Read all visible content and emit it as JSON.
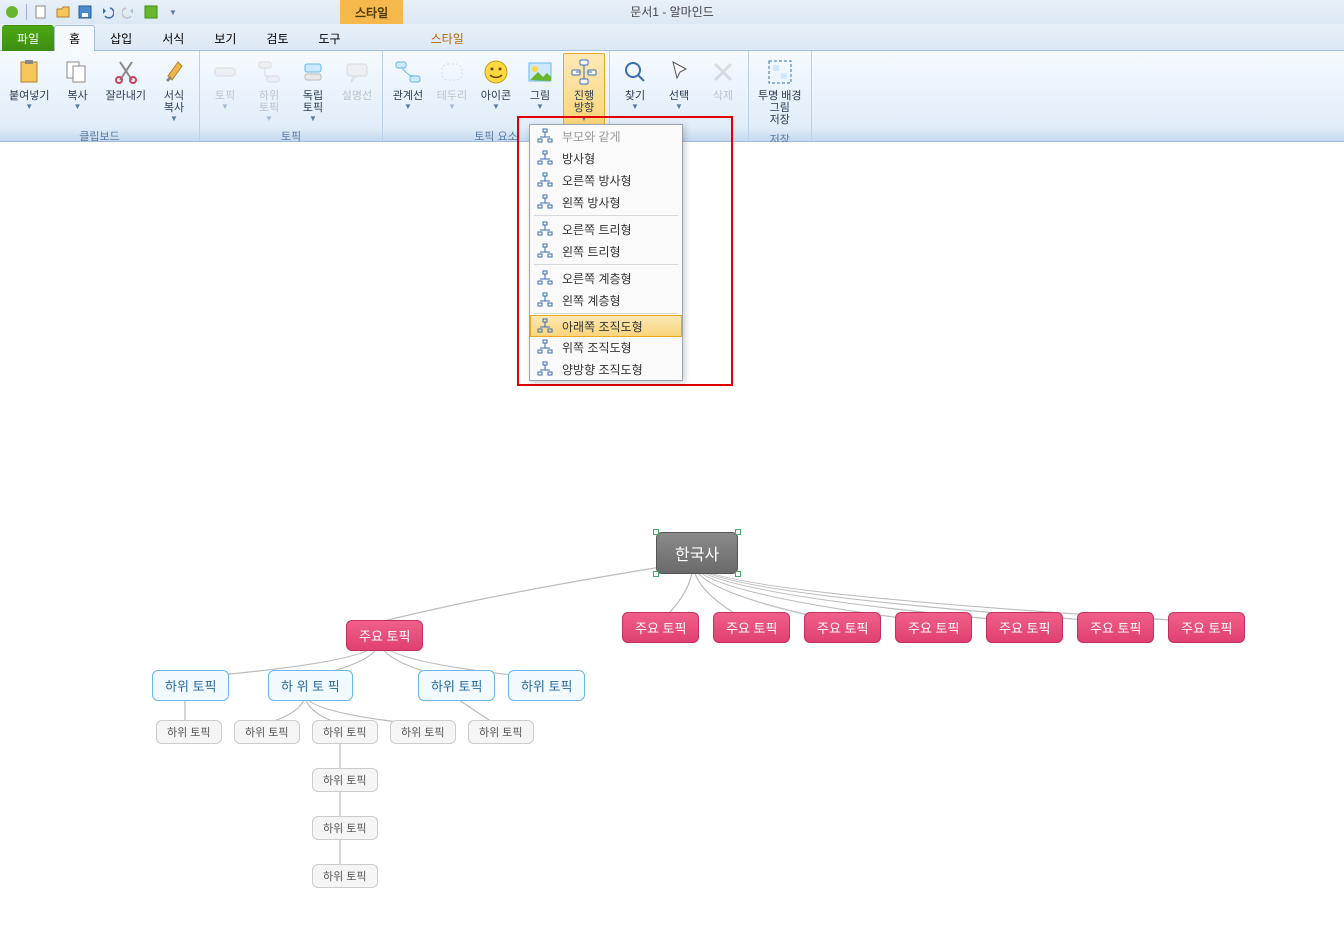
{
  "app": {
    "document_title": "문서1 - 알마인드",
    "context_tab_group": "스타일"
  },
  "tabs": {
    "file": "파일",
    "items": [
      {
        "label": "홈",
        "active": true
      },
      {
        "label": "삽입"
      },
      {
        "label": "서식"
      },
      {
        "label": "보기"
      },
      {
        "label": "검토"
      },
      {
        "label": "도구"
      },
      {
        "label": "스타일",
        "context": true
      }
    ]
  },
  "ribbon": {
    "groups": [
      {
        "name": "클립보드",
        "buttons": [
          {
            "key": "paste",
            "label": "붙여넣기",
            "dd": true
          },
          {
            "key": "copy",
            "label": "복사",
            "dd": true
          },
          {
            "key": "cut",
            "label": "잘라내기"
          },
          {
            "key": "format-copy",
            "label": "서식\n복사",
            "dd": true
          }
        ]
      },
      {
        "name": "토픽",
        "buttons": [
          {
            "key": "topic",
            "label": "토픽",
            "disabled": true,
            "dd": true
          },
          {
            "key": "subtopic",
            "label": "하위\n토픽",
            "disabled": true,
            "dd": true
          },
          {
            "key": "independent-topic",
            "label": "독립\n토픽",
            "dd": true
          },
          {
            "key": "callout",
            "label": "설명선",
            "disabled": true
          }
        ]
      },
      {
        "name": "토픽 요소",
        "buttons": [
          {
            "key": "relationship",
            "label": "관계선",
            "dd": true
          },
          {
            "key": "boundary",
            "label": "테두리",
            "disabled": true,
            "dd": true
          },
          {
            "key": "icon",
            "label": "아이콘",
            "dd": true
          },
          {
            "key": "image",
            "label": "그림",
            "dd": true
          },
          {
            "key": "direction",
            "label": "진행\n방향",
            "active": true,
            "dd": true
          }
        ]
      },
      {
        "name": "",
        "buttons": [
          {
            "key": "find",
            "label": "찾기",
            "dd": true
          },
          {
            "key": "select",
            "label": "선택",
            "dd": true
          },
          {
            "key": "delete",
            "label": "삭제",
            "disabled": true
          }
        ]
      },
      {
        "name": "저장",
        "buttons": [
          {
            "key": "transparent-bg",
            "label": "투명 배경\n그림\n저장"
          }
        ]
      }
    ]
  },
  "dropdown": {
    "items": [
      {
        "label": "부모와 같게",
        "icon": "same-parent",
        "disabled": true
      },
      {
        "label": "방사형",
        "icon": "radial"
      },
      {
        "label": "오른쪽 방사형",
        "icon": "radial-right"
      },
      {
        "label": "왼쪽 방사형",
        "icon": "radial-left"
      },
      {
        "sep": true
      },
      {
        "label": "오른쪽 트리형",
        "icon": "tree-right"
      },
      {
        "label": "왼쪽 트리형",
        "icon": "tree-left"
      },
      {
        "sep": true
      },
      {
        "label": "오른쪽 계층형",
        "icon": "hier-right"
      },
      {
        "label": "왼쪽 계층형",
        "icon": "hier-left"
      },
      {
        "sep": true
      },
      {
        "label": "아래쪽 조직도형",
        "icon": "org-down",
        "selected": true
      },
      {
        "label": "위쪽 조직도형",
        "icon": "org-up"
      },
      {
        "label": "양방향 조직도형",
        "icon": "org-both"
      }
    ]
  },
  "mindmap": {
    "root": "한국사",
    "main_topics": [
      "주요 토픽",
      "주요 토픽",
      "주요 토픽",
      "주요 토픽",
      "주요 토픽",
      "주요 토픽",
      "주요 토픽",
      "주요 토픽"
    ],
    "sub_blue": [
      "하위 토픽",
      "하 위 토 픽",
      "하위 토픽",
      "하위 토픽"
    ],
    "sub_gray_row1": [
      "하위 토픽",
      "하위 토픽",
      "하위 토픽",
      "하위 토픽",
      "하위 토픽"
    ],
    "sub_gray_col": [
      "하위 토픽",
      "하위 토픽",
      "하위 토픽"
    ]
  }
}
